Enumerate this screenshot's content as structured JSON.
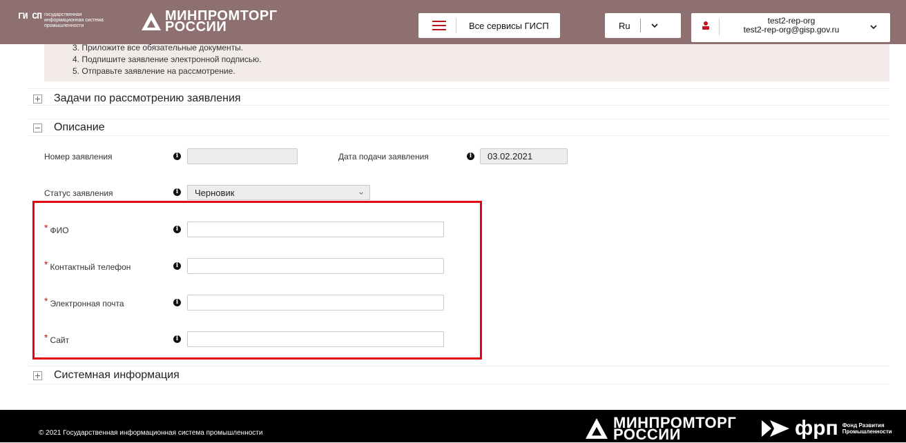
{
  "header": {
    "gisp_mark": "ГИ СП",
    "gisp_lines": [
      "государственная",
      "информационная система",
      "промышленности"
    ],
    "ministry_lines": [
      "МИНПРОМТОРГ",
      "РОССИИ"
    ],
    "services_label": "Все сервисы ГИСП",
    "language": "Ru",
    "user_name": "test2-rep-org",
    "user_email": "test2-rep-org@gisp.gov.ru"
  },
  "instructions": [
    "3. Приложите все обязательные документы.",
    "4. Подпишите заявление электронной подписью.",
    "5. Отправьте заявление на рассмотрение."
  ],
  "sections": {
    "tasks": "Задачи по рассмотрению заявления",
    "description": "Описание",
    "system_info": "Системная информация"
  },
  "form": {
    "number": {
      "label": "Номер заявления",
      "value": ""
    },
    "date": {
      "label": "Дата подачи заявления",
      "value": "03.02.2021"
    },
    "status": {
      "label": "Статус заявления",
      "value": "Черновик"
    },
    "required_mark": "*",
    "fio": {
      "label": "ФИО",
      "value": ""
    },
    "phone": {
      "label": "Контактный телефон",
      "value": ""
    },
    "email": {
      "label": "Электронная почта",
      "value": ""
    },
    "site": {
      "label": "Сайт",
      "value": ""
    }
  },
  "footer": {
    "copyright": "© 2021 Государственная информационная система промышленности",
    "ministry_lines": [
      "МИНПРОМТОРГ",
      "РОССИИ"
    ],
    "frp_name": "фрп",
    "frp_sub": [
      "Фонд Развития",
      "Промышленности"
    ]
  },
  "colors": {
    "header_bg": "#8f7070",
    "accent_red": "#c0141b",
    "highlight_red": "#e3000f",
    "footer_bg": "#000000",
    "instructions_bg": "#f3ebea"
  }
}
